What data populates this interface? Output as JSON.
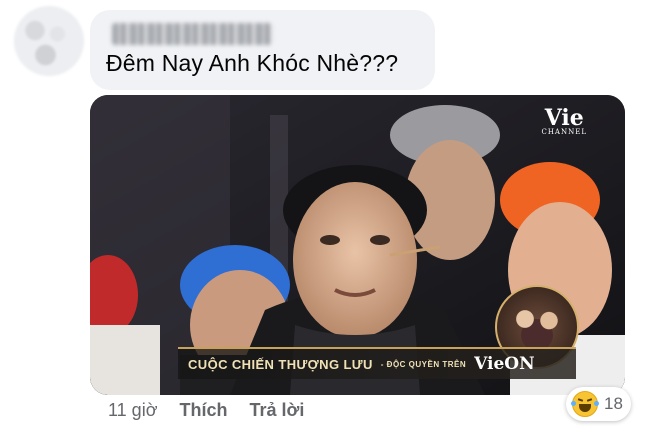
{
  "comment": {
    "text": "Đêm Nay Anh Khóc Nhè???"
  },
  "media": {
    "watermark": "Vie",
    "watermark_sub": "CHANNEL",
    "banner_title": "CUỘC CHIẾN THƯỢNG LƯU",
    "banner_sub": "- ĐỘC QUYỀN TRÊN",
    "banner_brand": "VieON"
  },
  "meta": {
    "time": "11 giờ",
    "like_label": "Thích",
    "reply_label": "Trả lời"
  },
  "reaction": {
    "icon": "haha-emoji-icon",
    "count": "18"
  },
  "colors": {
    "bubble_bg": "#f0f2f5",
    "meta_text": "#65676b",
    "banner_accent": "#c8a25a"
  }
}
